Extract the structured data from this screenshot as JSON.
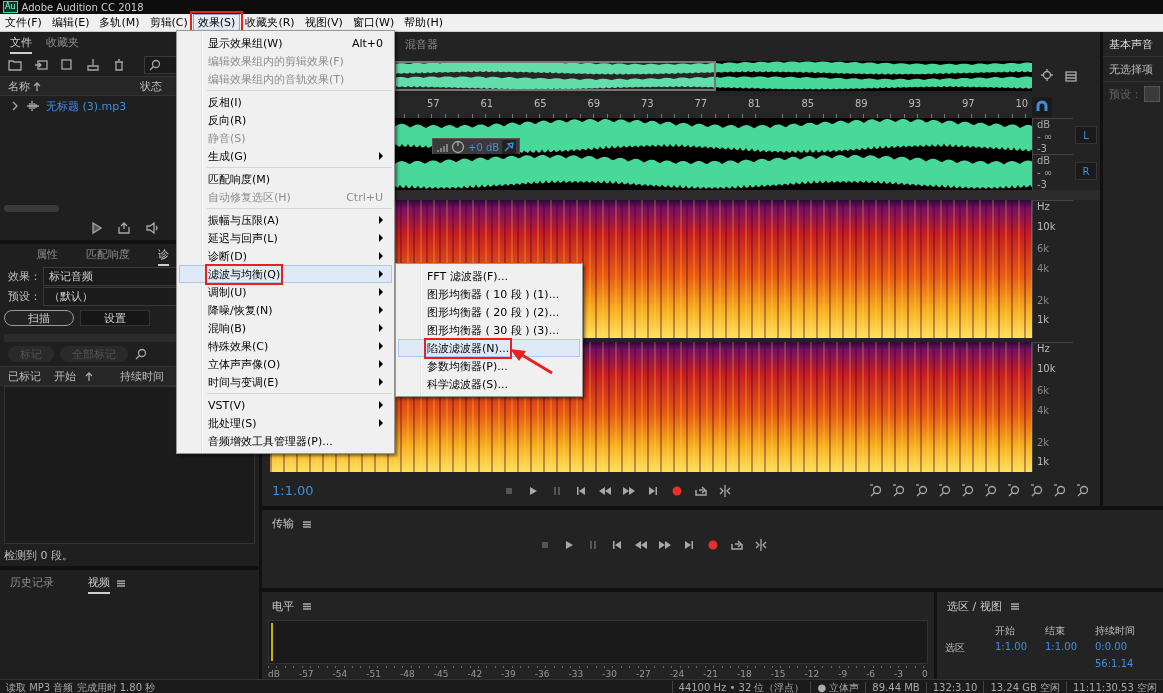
{
  "window": {
    "app_icon": "Au",
    "title": "Adobe Audition CC 2018"
  },
  "menubar": {
    "items": [
      {
        "label": "文件(F)",
        "selected": false,
        "annotated": false
      },
      {
        "label": "编辑(E)",
        "selected": false,
        "annotated": false
      },
      {
        "label": "多轨(M)",
        "selected": false,
        "annotated": false
      },
      {
        "label": "剪辑(C)",
        "selected": false,
        "annotated": false
      },
      {
        "label": "效果(S)",
        "selected": true,
        "annotated": true
      },
      {
        "label": "收藏夹(R)",
        "selected": false,
        "annotated": false
      },
      {
        "label": "视图(V)",
        "selected": false,
        "annotated": false
      },
      {
        "label": "窗口(W)",
        "selected": false,
        "annotated": false
      },
      {
        "label": "帮助(H)",
        "selected": false,
        "annotated": false
      }
    ]
  },
  "effects_menu": {
    "items": [
      {
        "kind": "item",
        "label": "显示效果组(W)",
        "shortcut": "Alt+0",
        "disabled": false,
        "submenu": false,
        "selected": false,
        "annotated": false
      },
      {
        "kind": "item",
        "label": "编辑效果组内的剪辑效果(F)",
        "disabled": true,
        "submenu": false,
        "selected": false,
        "annotated": false
      },
      {
        "kind": "item",
        "label": "编辑效果组内的音轨效果(T)",
        "disabled": true,
        "submenu": false,
        "selected": false,
        "annotated": false
      },
      {
        "kind": "separator"
      },
      {
        "kind": "item",
        "label": "反相(I)",
        "disabled": false,
        "submenu": false,
        "selected": false,
        "annotated": false
      },
      {
        "kind": "item",
        "label": "反向(R)",
        "disabled": false,
        "submenu": false,
        "selected": false,
        "annotated": false
      },
      {
        "kind": "item",
        "label": "静音(S)",
        "disabled": true,
        "submenu": false,
        "selected": false,
        "annotated": false
      },
      {
        "kind": "item",
        "label": "生成(G)",
        "disabled": false,
        "submenu": true,
        "selected": false,
        "annotated": false
      },
      {
        "kind": "separator"
      },
      {
        "kind": "item",
        "label": "匹配响度(M)",
        "disabled": false,
        "submenu": false,
        "selected": false,
        "annotated": false
      },
      {
        "kind": "item",
        "label": "自动修复选区(H)",
        "shortcut": "Ctrl+U",
        "disabled": true,
        "submenu": false,
        "selected": false,
        "annotated": false
      },
      {
        "kind": "separator"
      },
      {
        "kind": "item",
        "label": "振幅与压限(A)",
        "disabled": false,
        "submenu": true,
        "selected": false,
        "annotated": false
      },
      {
        "kind": "item",
        "label": "延迟与回声(L)",
        "disabled": false,
        "submenu": true,
        "selected": false,
        "annotated": false
      },
      {
        "kind": "item",
        "label": "诊断(D)",
        "disabled": false,
        "submenu": true,
        "selected": false,
        "annotated": false
      },
      {
        "kind": "item",
        "label": "滤波与均衡(Q)",
        "disabled": false,
        "submenu": true,
        "selected": true,
        "annotated": true
      },
      {
        "kind": "item",
        "label": "调制(U)",
        "disabled": false,
        "submenu": true,
        "selected": false,
        "annotated": false
      },
      {
        "kind": "item",
        "label": "降噪/恢复(N)",
        "disabled": false,
        "submenu": true,
        "selected": false,
        "annotated": false
      },
      {
        "kind": "item",
        "label": "混响(B)",
        "disabled": false,
        "submenu": true,
        "selected": false,
        "annotated": false
      },
      {
        "kind": "item",
        "label": "特殊效果(C)",
        "disabled": false,
        "submenu": true,
        "selected": false,
        "annotated": false
      },
      {
        "kind": "item",
        "label": "立体声声像(O)",
        "disabled": false,
        "submenu": true,
        "selected": false,
        "annotated": false
      },
      {
        "kind": "item",
        "label": "时间与变调(E)",
        "disabled": false,
        "submenu": true,
        "selected": false,
        "annotated": false
      },
      {
        "kind": "separator"
      },
      {
        "kind": "item",
        "label": "VST(V)",
        "disabled": false,
        "submenu": true,
        "selected": false,
        "annotated": false
      },
      {
        "kind": "item",
        "label": "批处理(S)",
        "disabled": false,
        "submenu": true,
        "selected": false,
        "annotated": false
      },
      {
        "kind": "item",
        "label": "音频增效工具管理器(P)...",
        "disabled": false,
        "submenu": false,
        "selected": false,
        "annotated": false
      }
    ]
  },
  "filter_submenu": {
    "items": [
      {
        "label": "FFT 滤波器(F)...",
        "selected": false,
        "annotated": false
      },
      {
        "label": "图形均衡器 ( 10 段 ) (1)...",
        "selected": false,
        "annotated": false
      },
      {
        "label": "图形均衡器 ( 20 段 ) (2)...",
        "selected": false,
        "annotated": false
      },
      {
        "label": "图形均衡器 ( 30 段 ) (3)...",
        "selected": false,
        "annotated": false
      },
      {
        "label": "陷波滤波器(N)...",
        "selected": true,
        "annotated": true
      },
      {
        "label": "参数均衡器(P)...",
        "selected": false,
        "annotated": false
      },
      {
        "label": "科学滤波器(S)...",
        "selected": false,
        "annotated": false
      }
    ]
  },
  "files_panel": {
    "tabs": [
      {
        "label": "文件",
        "selected": true
      },
      {
        "label": "收藏夹",
        "selected": false
      }
    ],
    "columns": [
      "名称",
      "状态"
    ],
    "files": [
      {
        "name": "无标题 (3).mp3",
        "expanded": false
      }
    ]
  },
  "diagnostics_panel": {
    "tabs": [
      {
        "label": "属性",
        "selected": false
      },
      {
        "label": "匹配响度",
        "selected": false
      },
      {
        "label": "诊",
        "selected": true
      }
    ],
    "effect_label": "效果：",
    "effect": "标记音频",
    "preset_label": "预设：",
    "preset": "（默认）",
    "buttons": [
      {
        "label": "扫描",
        "kind": "pill"
      },
      {
        "label": "设置",
        "kind": "box"
      }
    ],
    "mark_buttons": [
      {
        "label": "标记",
        "disabled": true
      },
      {
        "label": "全部标记",
        "disabled": true
      }
    ],
    "columns": [
      "已标记",
      "开始",
      "持续时间"
    ],
    "status": "检测到 0 段。"
  },
  "history_panel": {
    "tabs": [
      {
        "label": "历史记录",
        "selected": false
      },
      {
        "label": "视频",
        "selected": true
      }
    ]
  },
  "editor": {
    "tab": "混音器",
    "ruler": [
      "57",
      "61",
      "65",
      "69",
      "73",
      "77",
      "81",
      "85",
      "89",
      "93",
      "97",
      "10"
    ],
    "volume": "+0 dB",
    "channels": [
      {
        "label": "L",
        "scale": [
          "dB",
          "- ∞",
          "-3"
        ]
      },
      {
        "label": "R",
        "scale": [
          "dB",
          "- ∞",
          "-3"
        ]
      }
    ],
    "spectrum_scales": [
      [
        "Hz",
        "10k",
        "6k",
        "4k",
        "2k",
        "1k"
      ],
      [
        "Hz",
        "10k",
        "6k",
        "4k",
        "2k",
        "1k"
      ]
    ],
    "time": "1:1.00"
  },
  "transport_panel": {
    "title": "传输"
  },
  "level_panel": {
    "title": "电平",
    "scale": [
      "dB",
      "-57",
      "-54",
      "-51",
      "-48",
      "-45",
      "-42",
      "-39",
      "-36",
      "-33",
      "-30",
      "-27",
      "-24",
      "-21",
      "-18",
      "-15",
      "-12",
      "-9",
      "-6",
      "-3",
      "0"
    ]
  },
  "essential_sound": {
    "title": "基本声音",
    "message": "无选择项",
    "preset_label": "预设："
  },
  "selection_panel": {
    "title": "选区 / 视图",
    "columns": [
      "开始",
      "结束",
      "持续时间"
    ],
    "rows": [
      {
        "label": "选区",
        "start": "1:1.00",
        "end": "1:1.00",
        "duration": "0:0.00"
      },
      {
        "duration": "56:1.14"
      }
    ]
  },
  "status_bar": {
    "message": "读取 MP3 音频 完成用时 1.80 秒",
    "fields": [
      "44100 Hz • 32 位（浮点）",
      "● 立体声",
      "89.44 MB",
      "132:3.10",
      "13.24 GB 空闲",
      "11:11:30.53 空闲"
    ]
  }
}
